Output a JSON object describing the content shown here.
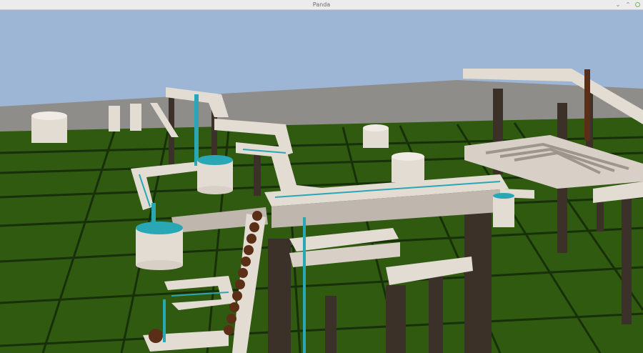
{
  "window": {
    "title": "Panda",
    "controls": {
      "minimize": "⌄",
      "maximize": "⌃"
    }
  },
  "colors": {
    "sky": "#9db6d6",
    "far_wall": "#8e8d8a",
    "ground": "#2f5a10",
    "ground_dark": "#17300a",
    "track": "#e3dcd3",
    "track_side": "#bfb7ad",
    "water": "#2aa7b5",
    "pillar": "#3b3128",
    "bead": "#5a2e17",
    "accent_close": "#6cbf4e"
  }
}
